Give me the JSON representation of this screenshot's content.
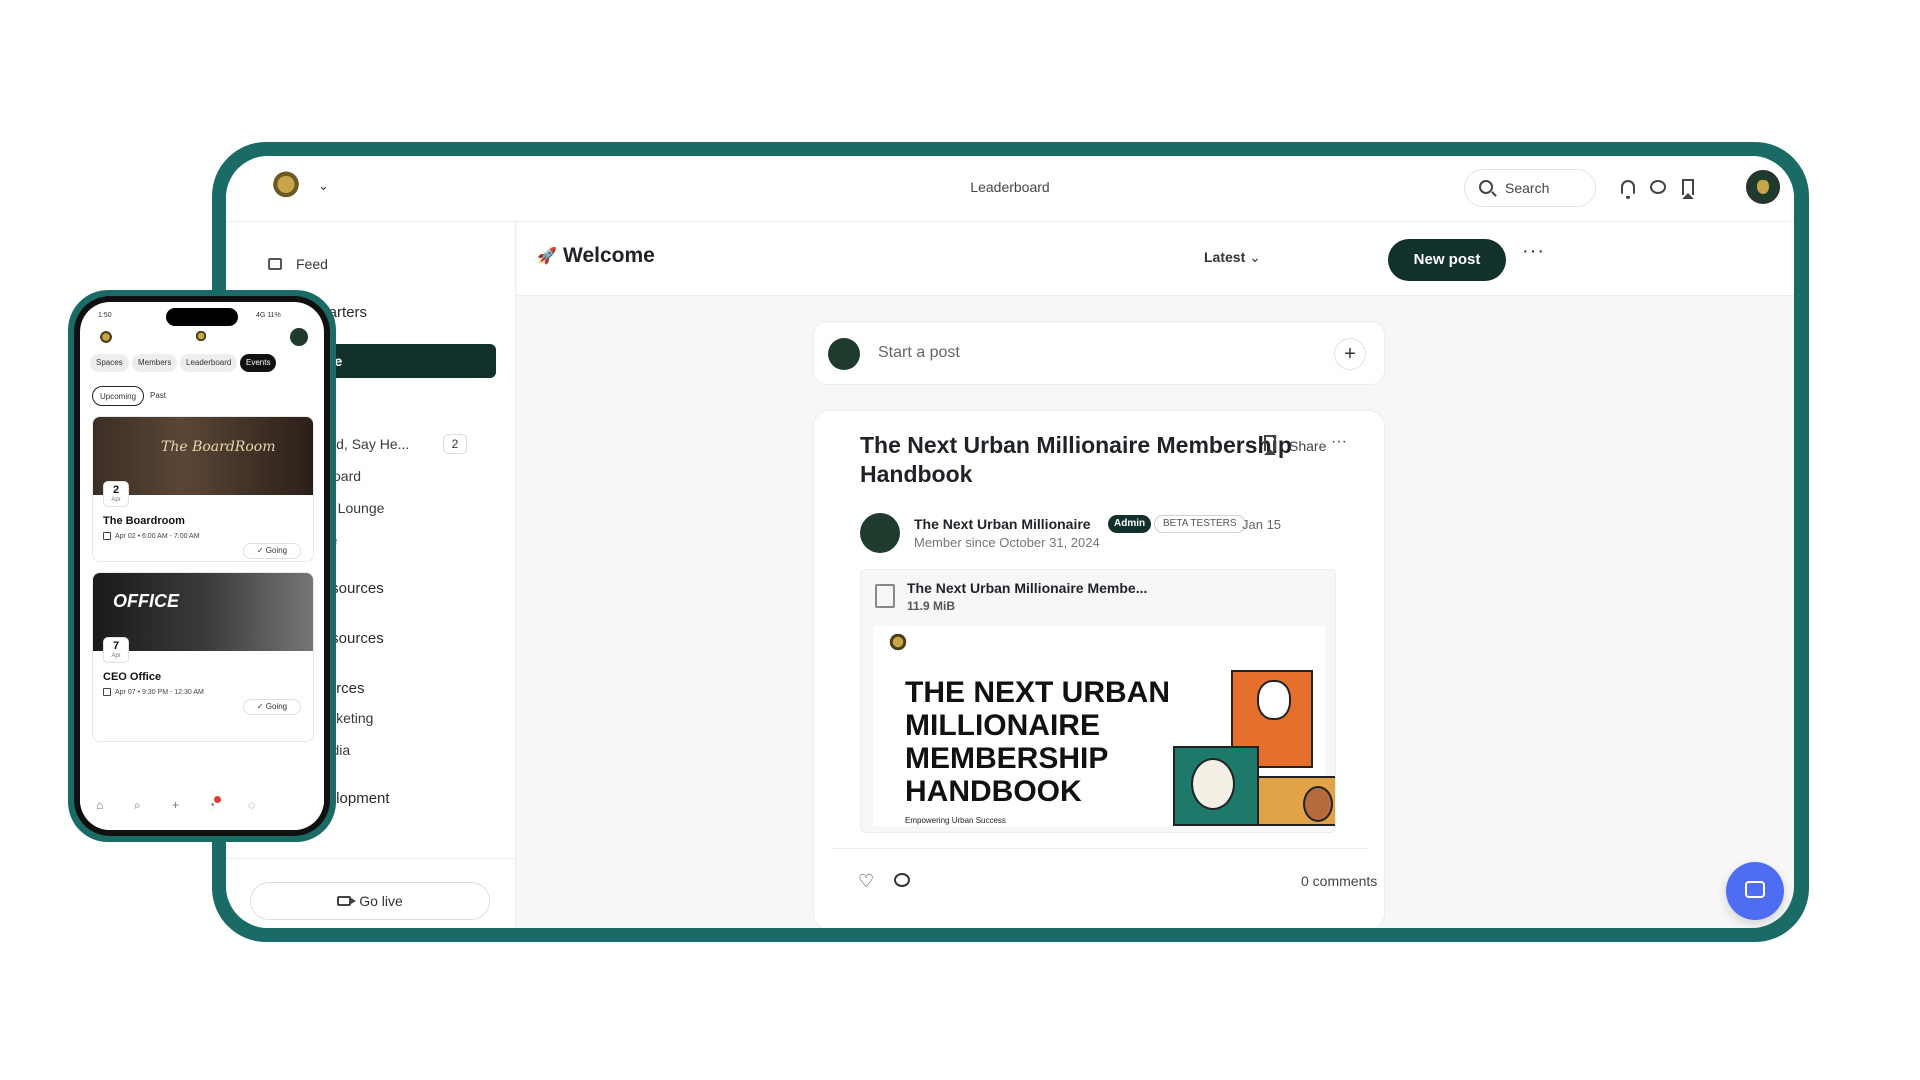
{
  "topbar": {
    "title": "Leaderboard",
    "search_label": "Search"
  },
  "sidebar": {
    "feed": "Feed",
    "items": [
      {
        "label": "quarters"
      },
      {
        "label": "me"
      },
      {
        "label": "arted, Say He...",
        "badge": "2"
      },
      {
        "label": "n Board"
      },
      {
        "label": "tive Lounge"
      },
      {
        "label": "ffice"
      },
      {
        "label": "Resources"
      },
      {
        "label": "Resources"
      },
      {
        "label": "sources"
      },
      {
        "label": "Marketing"
      },
      {
        "label": "Media"
      },
      {
        "label": "evelopment"
      }
    ],
    "go_live": "Go live"
  },
  "main": {
    "space_title": "Welcome",
    "sort": "Latest",
    "new_post": "New post",
    "composer_placeholder": "Start a post"
  },
  "post": {
    "title": "The Next Urban Millionaire Membership Handbook",
    "share": "Share",
    "author": "The Next Urban Millionaire",
    "admin_badge": "Admin",
    "tag": "BETA TESTERS",
    "date": "Jan 15",
    "member_since": "Member since October 31, 2024",
    "attachment_name": "The Next Urban Millionaire Membe...",
    "attachment_size": "11.9 MiB",
    "preview_title": "THE NEXT URBAN MILLIONAIRE MEMBERSHIP HANDBOOK",
    "preview_subtitle": "Empowering Urban Success",
    "comments": "0 comments"
  },
  "phone": {
    "status_time": "1:50",
    "status_right": "4G 11%",
    "tabs": [
      "Spaces",
      "Members",
      "Leaderboard",
      "Events"
    ],
    "active_tab": "Events",
    "segments": [
      "Upcoming",
      "Past"
    ],
    "events": [
      {
        "image_text": "The BoardRoom",
        "day": "2",
        "month": "Apr",
        "title": "The Boardroom",
        "time": "Apr 02 • 6:00 AM - 7:00 AM",
        "rsvp": "Going"
      },
      {
        "image_text": "OFFICE",
        "day": "7",
        "month": "Apr",
        "title": "CEO Office",
        "time": "Apr 07 • 9:30 PM - 12:30 AM",
        "rsvp": "Going"
      }
    ]
  },
  "colors": {
    "frame_teal": "#1a6b66",
    "primary_dark": "#12302c",
    "chat_fab": "#4e6df3"
  }
}
